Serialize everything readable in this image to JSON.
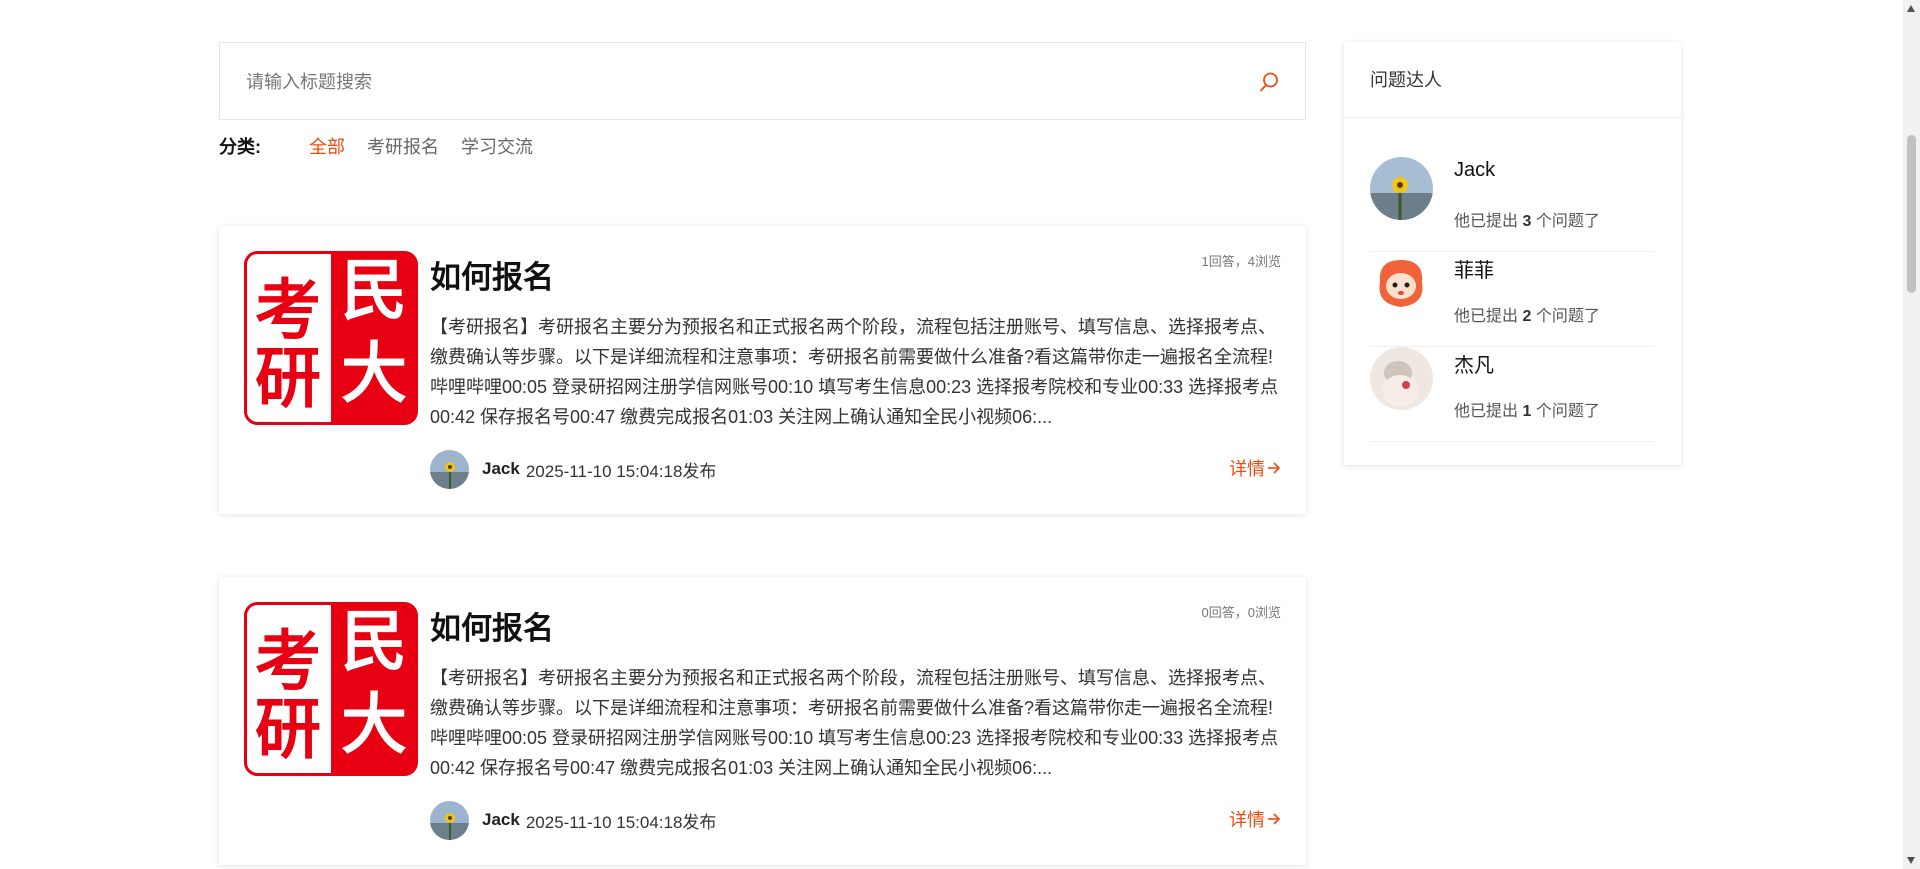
{
  "colors": {
    "accent": "#f04a0c",
    "logo_red": "#e60012"
  },
  "search": {
    "placeholder": "请输入标题搜索",
    "icon": "search-icon"
  },
  "categories": {
    "label": "分类:",
    "items": [
      {
        "label": "全部",
        "active": true
      },
      {
        "label": "考研报名",
        "active": false
      },
      {
        "label": "学习交流",
        "active": false
      }
    ]
  },
  "questions": [
    {
      "thumb_chars": [
        "考",
        "民",
        "研",
        "大"
      ],
      "title": "如何报名",
      "stats": "1回答，4浏览",
      "excerpt": "【考研报名】考研报名主要分为预报名和正式报名两个阶段，流程包括注册账号、填写信息、选择报考点、缴费确认等步骤。以下是详细流程和注意事项：考研报名前需要做什么准备?看这篇带你走一遍报名全流程!哔哩哔哩00:05 登录研招网注册学信网账号00:10 填写考生信息00:23 选择报考院校和专业00:33 选择报考点00:42 保存报名号00:47 缴费完成报名01:03 关注网上确认通知全民小视频06:...",
      "author": "Jack",
      "time": "2025-11-10 15:04:18发布",
      "detail": "详情"
    },
    {
      "thumb_chars": [
        "考",
        "民",
        "研",
        "大"
      ],
      "title": "如何报名",
      "stats": "0回答，0浏览",
      "excerpt": "【考研报名】考研报名主要分为预报名和正式报名两个阶段，流程包括注册账号、填写信息、选择报考点、缴费确认等步骤。以下是详细流程和注意事项：考研报名前需要做什么准备?看这篇带你走一遍报名全流程!哔哩哔哩00:05 登录研招网注册学信网账号00:10 填写考生信息00:23 选择报考院校和专业00:33 选择报考点00:42 保存报名号00:47 缴费完成报名01:03 关注网上确认通知全民小视频06:...",
      "author": "Jack",
      "time": "2025-11-10 15:04:18发布",
      "detail": "详情"
    }
  ],
  "sidebar": {
    "title": "问题达人",
    "users": [
      {
        "name": "Jack",
        "prefix": "他已提出",
        "count": "3",
        "suffix": "个问题了"
      },
      {
        "name": "菲菲",
        "prefix": "他已提出",
        "count": "2",
        "suffix": "个问题了"
      },
      {
        "name": "杰凡",
        "prefix": "他已提出",
        "count": "1",
        "suffix": "个问题了"
      }
    ]
  }
}
